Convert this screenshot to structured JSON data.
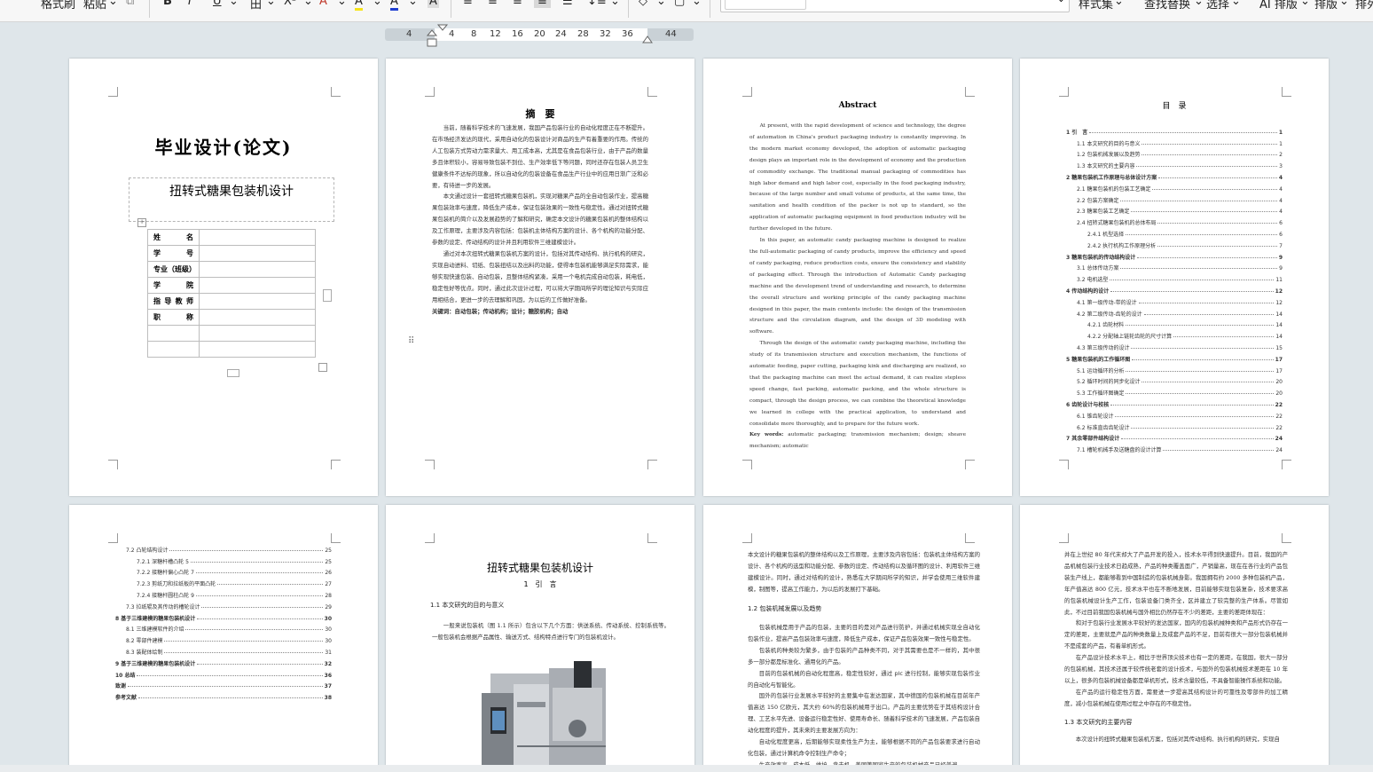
{
  "toolbar": {
    "format_painter": "格式刷",
    "paste": "粘贴",
    "bold": "B",
    "italic": "I",
    "underline": "U",
    "strike": "田",
    "superscript": "X²",
    "font_color_a": "A",
    "highlight": "A",
    "text_color": "A",
    "char_shading": "A",
    "style_set": "样式集",
    "find_replace": "查找替换",
    "select": "选择",
    "ai_layout": "AI 排版",
    "layout": "排版",
    "arrange": "排列"
  },
  "ruler": {
    "ticks": [
      "4",
      "4",
      "8",
      "12",
      "16",
      "20",
      "24",
      "28",
      "32",
      "36",
      "44"
    ]
  },
  "page1": {
    "title": "毕业设计(论文)",
    "subject": "扭转式糖果包装机设计",
    "rows": [
      {
        "k": "姓 名",
        "v": ""
      },
      {
        "k": "学 号",
        "v": ""
      },
      {
        "k": "专业（班级）",
        "v": ""
      },
      {
        "k": "学 院",
        "v": ""
      },
      {
        "k": "指导教师",
        "v": ""
      },
      {
        "k": "职 称",
        "v": ""
      },
      {
        "k": "",
        "v": ""
      },
      {
        "k": "",
        "v": ""
      }
    ]
  },
  "page2": {
    "heading": "摘　要",
    "p1": "当前，随着科学技术的飞速发展，我国产品包装行业的自动化程度正在不断提升。在市场经济发达的现代，采用自动化的包装设计对商品的生产有着重要的作用。传统的人工包装方式劳动力需求量大、用工成本高，尤其是在食品包装行业，由于产品的数量多且体积较小，容易导致包装不到位、生产效率低下等问题，同时还存在包装人员卫生健康条件不达标的现象，所以自动化的包装设备在食品生产行业中的应用日渐广泛和必要，有待进一步的发展。",
    "p2": "本文通过设计一套扭转式糖果包装机，实现对糖果产品的全自动包装作业，提高糖果包装效率与速度，降低生产成本，保证包装效果的一致性与稳定性。通过对扭转式糖果包装机的简介以及发展趋势的了解和研究，确定本文设计的糖果包装机的整体结构以及工作原理，主要涉及内容包括：包装机主体结构方案的设计、各个机构的功能分配、参数的设定、传动结构的设计并且利用软件三维建模设计。",
    "p3": "通过对本次扭转式糖果包装机方案的设计，包括对其传动结构、执行机构的研究，实现自动进料、切纸、包装扭结以及出料的功能，使得本包装机能够满足实际需求，能够实现快速包装、自动包装，且整体结构紧凑，采用一个电机完成自动包装，耗电低，稳定性好等优点。同时，通过此次设计过程，可以将大学期间所学的理论知识与实际应用相结合，更进一步的去理解和巩固，为以后的工作做好准备。",
    "kw": "关键词：自动包装；传动机构；设计；糖胶机构；自动"
  },
  "page3": {
    "heading": "Abstract",
    "p1": "At present, with the rapid development of science and technology, the degree of automation in China's product packaging industry is constantly improving. In the modern market economy developed, the adoption of automatic packaging design plays an important role in the development of economy and the production of commodity exchange. The traditional manual packaging of commodities has high labor demand and high labor cost, especially in the food packaging industry, because of the large number and small volume of products, at the same time, the sanitation and health condition of the packer is not up to standard, so the application of automatic packaging equipment in food production industry will be further developed in the future.",
    "p2": "In this paper, an automatic candy packaging machine is designed to realize the full-automatic packaging of candy products, improve the efficiency and speed of candy packaging, reduce production costs, ensure the consistency and stability of packaging effect. Through the introduction of Automatic Candy packaging machine and the development trend of understanding and research, to determine the overall structure and working principle of the candy packaging machine designed in this paper, the main contents include: the design of the transmission structure and the circulation diagram, and the design of 3D modeling with software.",
    "p3": "Through the design of the automatic candy packaging machine, including the study of its transmission structure and execution mechanism, the functions of automatic feeding, paper cutting, packaging kink and discharging are realized, so that the packaging machine can meet the actual demand, it can realize stepless speed change, fast packing, automatic packing, and the whole structure is compact, through the design process, we can combine the theoretical knowledge we learned in college with the practical application, to understand and consolidate more thoroughly, and to prepare for the future work.",
    "kw_label": "Key words:",
    "kw": "automatic packaging; transmission mechanism; design; sheave mechanism; automatic"
  },
  "page4": {
    "heading": "目　录",
    "items": [
      {
        "t": "1 引　言",
        "p": "1",
        "b": true,
        "i": 0
      },
      {
        "t": "1.1 本文研究的目的与意义",
        "p": "1",
        "b": false,
        "i": 1
      },
      {
        "t": "1.2 包装机械发展以及趋势",
        "p": "2",
        "b": false,
        "i": 1
      },
      {
        "t": "1.3 本文研究的主要内容",
        "p": "3",
        "b": false,
        "i": 1
      },
      {
        "t": "2 糖果包装机工作原理与总体设计方案",
        "p": "4",
        "b": true,
        "i": 0
      },
      {
        "t": "2.1 糖果包装机的包装工艺确定",
        "p": "4",
        "b": false,
        "i": 1
      },
      {
        "t": "2.2 包装方案确定",
        "p": "4",
        "b": false,
        "i": 1
      },
      {
        "t": "2.3 糖果包装工艺确定",
        "p": "4",
        "b": false,
        "i": 1
      },
      {
        "t": "2.4 扭转式糖果包装机的总体布局",
        "p": "6",
        "b": false,
        "i": 1
      },
      {
        "t": "2.4.1 机型选择",
        "p": "6",
        "b": false,
        "i": 2
      },
      {
        "t": "2.4.2 执行机构工作原理分析",
        "p": "7",
        "b": false,
        "i": 2
      },
      {
        "t": "3 糖果包装机的传动结构设计",
        "p": "9",
        "b": true,
        "i": 0
      },
      {
        "t": "3.1 总体传动方案",
        "p": "9",
        "b": false,
        "i": 1
      },
      {
        "t": "3.2 电机选型",
        "p": "11",
        "b": false,
        "i": 1
      },
      {
        "t": "4 传动结构的设计",
        "p": "12",
        "b": true,
        "i": 0
      },
      {
        "t": "4.1 第一级传动-带的设计",
        "p": "12",
        "b": false,
        "i": 1
      },
      {
        "t": "4.2 第二级传动-齿轮的设计",
        "p": "14",
        "b": false,
        "i": 1
      },
      {
        "t": "4.2.1 齿轮材料",
        "p": "14",
        "b": false,
        "i": 2
      },
      {
        "t": "4.2.2 分配轴上链轮齿轮的尺寸计算",
        "p": "14",
        "b": false,
        "i": 2
      },
      {
        "t": "4.3 第三级传动的设计",
        "p": "15",
        "b": false,
        "i": 1
      },
      {
        "t": "5 糖果包装机的工作循环图",
        "p": "17",
        "b": true,
        "i": 0
      },
      {
        "t": "5.1 运动循环的分析",
        "p": "17",
        "b": false,
        "i": 1
      },
      {
        "t": "5.2 循环时间的同步化设计",
        "p": "20",
        "b": false,
        "i": 1
      },
      {
        "t": "5.3 工作循环图确定",
        "p": "20",
        "b": false,
        "i": 1
      },
      {
        "t": "6 齿轮设计与校核",
        "p": "22",
        "b": true,
        "i": 0
      },
      {
        "t": "6.1 锥齿轮设计",
        "p": "22",
        "b": false,
        "i": 1
      },
      {
        "t": "6.2 标准直齿齿轮设计",
        "p": "22",
        "b": false,
        "i": 1
      },
      {
        "t": "7 其余零部件结构设计",
        "p": "24",
        "b": true,
        "i": 0
      },
      {
        "t": "7.1 槽轮机械手及送糖盘的设计计算",
        "p": "24",
        "b": false,
        "i": 1
      }
    ]
  },
  "page5": {
    "items": [
      {
        "t": "7.2 凸轮结构设计",
        "p": "25",
        "b": false,
        "i": 1
      },
      {
        "t": "7.2.1 深糖杆槽凸轮 5",
        "p": "25",
        "b": false,
        "i": 2
      },
      {
        "t": "7.2.2 接糖杆偏心凸轮 7",
        "p": "26",
        "b": false,
        "i": 2
      },
      {
        "t": "7.2.3 剪纸刀和拉纸板的平面凸轮",
        "p": "27",
        "b": false,
        "i": 2
      },
      {
        "t": "7.2.4 接糖杆圆柱凸轮 9",
        "p": "28",
        "b": false,
        "i": 2
      },
      {
        "t": "7.3 拉纸辊及其传动的槽轮设计",
        "p": "29",
        "b": false,
        "i": 1
      },
      {
        "t": "8 基于三维建模的糖果包装机设计",
        "p": "30",
        "b": true,
        "i": 0
      },
      {
        "t": "8.1 三维建模软件的介绍",
        "p": "30",
        "b": false,
        "i": 1
      },
      {
        "t": "8.2 零部件建模",
        "p": "30",
        "b": false,
        "i": 1
      },
      {
        "t": "8.3 装配体绘制",
        "p": "31",
        "b": false,
        "i": 1
      },
      {
        "t": "9 基于三维建模的糖果包装机设计",
        "p": "32",
        "b": true,
        "i": 0
      },
      {
        "t": "10 总结",
        "p": "36",
        "b": true,
        "i": 0
      },
      {
        "t": "致谢",
        "p": "37",
        "b": true,
        "i": 0
      },
      {
        "t": "参考文献",
        "p": "38",
        "b": true,
        "i": 0
      }
    ]
  },
  "page6": {
    "title": "扭转式糖果包装机设计",
    "chapter": "1　引　言",
    "sec": "1.1 本文研究的目的与意义",
    "p1": "一般来说包装机（图 1.1 所示）包含以下几个方面：供送系统、传动系统、控制系统等。一般包装机会根据产品属性、输送方式、结构特点进行专门的包装机设计。"
  },
  "page7": {
    "p0": "本文设计的糖果包装机的整体结构以及工作原理，主要涉及内容包括：包装机主体结构方案的设计、各个机构的选型和功能分配、参数的设定、传动结构以及循环图的设计、利用软件三维建模设计。同时，通过对结构的设计，熟悉在大学期间所学的知识，并学会使用三维软件建模，制图等，提高工作能力，为以后的发展打下基础。",
    "sec": "1.2 包装机械发展以及趋势",
    "p1": "包装机械是用于产品的包装，主要的目的是对产品进行防护，并通过机械实现全自动化包装作业，提高产品包装效率与速度，降低生产成本，保证产品包装效果一致性与稳定性。",
    "p2": "包装机的种类较为繁多，由于包装的产品种类不同，对于其需要也是不一样的，其中很多一部分都是标准化、通用化的产品。",
    "p3": "目前的包装机械的自动化程度高，稳定性较好，通过 plc 进行控制，能够实现包装作业的自动化与智能化。",
    "p4": "国外的包装行业发展水平较好的主要集中在发达国家，其中德国的包装机械在目前年产值高达 150 亿欧元，其大约 60%的包装机械用于出口。产品的主要优势在于其结构设计合理、工艺水平先进、设备运行稳定性好、使用寿命长、随着科学技术的飞速发展，产品包装自动化程度的提升，其未来的主要发展方向为：",
    "p5": "自动化程度更高，后期能够实现柔性生产为主，能够根据不同的产品包装要求进行自动化包装，通过计算机命令控制生产命令；",
    "p6": "生产效率高，成本低，维护、拿去机，美国等国家生产的包装机械产品已经普遍"
  },
  "page8": {
    "p1": "并在上世纪 80 年代末却大了产品开发的投入，技术水平得到快速提升。目前，我国的产品机械包装行业技术日趋成熟，产品的种类覆盖面广，产销量高，现在在各行业的产品包装生产线上，都能够看到中国制造的包装机械身影。我国拥有约 2000 多种包装机产品，年产值高达 800 亿元，技术水平也在不断地发展，目前能够实现包装复杂，技术要求高的包装机械设计生产工作，包装设备门类齐全，区并建立了较完整的生产体系。尽管如此，不过目前我国包装机械与国外相比仍然存在不少的差距，主要的差距体现在：",
    "p2": "和对于包装行业发展水平较好的发达国家，国内的包装机械种类和产品形式仍存在一定的差距，主要就是产品的种类数量上及成套产品的不足，目前有很大一部分包装机械并不是成套的产品，有着单机形式。",
    "p3": "在产品设计技术水平上，相比于世界顶尖技术也有一定的差距，在我国，很大一部分的包装机械，其技术还属于较传统老套的设计技术，与国外的包装机械技术差距在 10 年以上，很多的包装机械设备都是单机形式，技术含量较低，不具备智能操作系统和功能。",
    "p4": "在产品的运行稳定性方面，需要进一步提高其结构设计的可靠性及零部件的加工精度，减小包装机械在使用过程之中存在的不稳定性。",
    "sec": "1.3 本文研究的主要内容",
    "p5": "本次设计的扭转式糖果包装机方案，包括对其传动结构、执行机构的研究，实现自"
  }
}
